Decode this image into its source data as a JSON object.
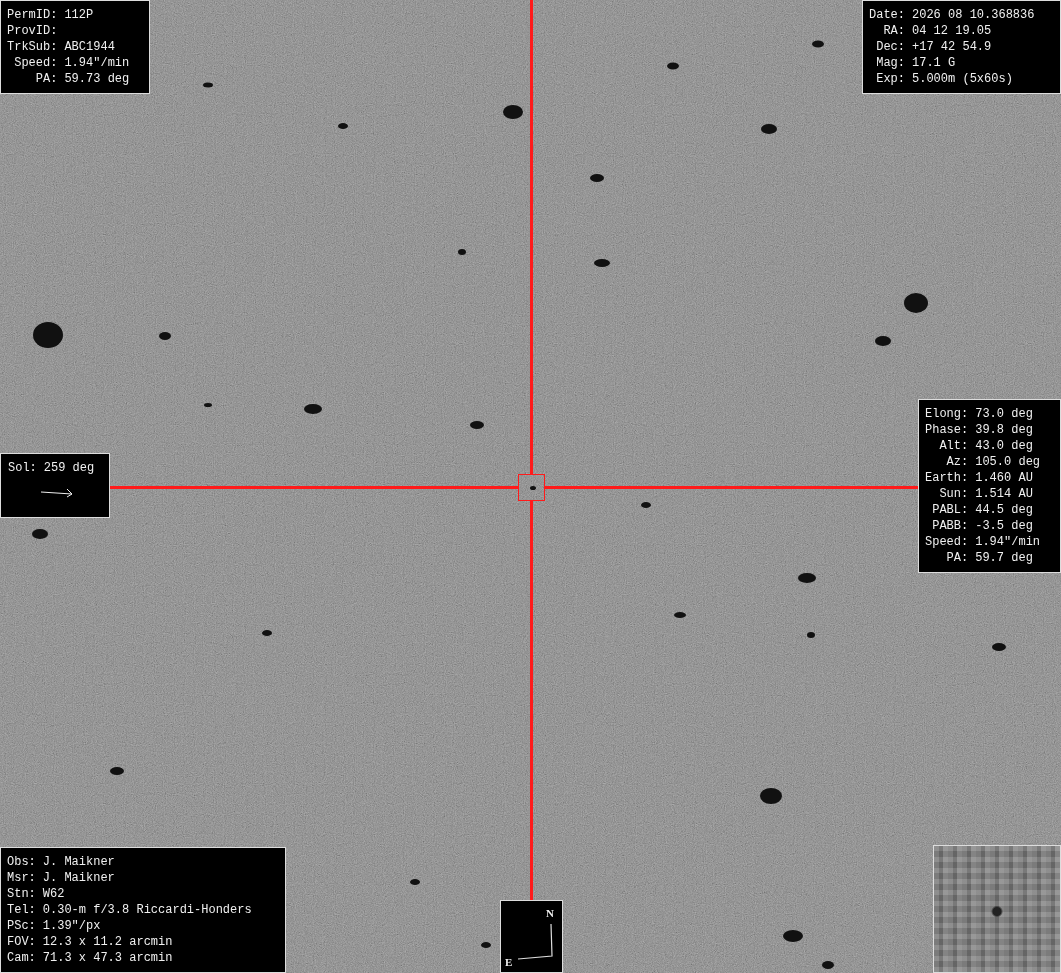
{
  "target": {
    "lines": [
      {
        "label": "PermID:",
        "value": "112P"
      },
      {
        "label": "ProvID:"
      },
      {
        "label": "TrkSub:",
        "value": "ABC1944"
      },
      {
        "label": "Speed:",
        "value": "1.94\"/min"
      },
      {
        "label": "PA:",
        "value": "59.73 deg"
      }
    ]
  },
  "observation": {
    "lines": [
      {
        "label": "Date:",
        "value": "2026 08 10.368836"
      },
      {
        "label": "RA:",
        "value": "04 12 19.05"
      },
      {
        "label": "Dec:",
        "value": "+17 42 54.9"
      },
      {
        "label": "Mag:",
        "value": "17.1 G"
      },
      {
        "label": "Exp:",
        "value": "5.000m (5x60s)"
      }
    ]
  },
  "geometry": {
    "lines": [
      {
        "label": "Elong:",
        "value": "73.0 deg"
      },
      {
        "label": "Phase:",
        "value": "39.8 deg"
      },
      {
        "label": "Alt:",
        "value": "43.0 deg"
      },
      {
        "label": "Az:",
        "value": "105.0 deg"
      },
      {
        "label": "Earth:",
        "value": "1.460 AU"
      },
      {
        "label": "Sun:",
        "value": "1.514 AU"
      },
      {
        "label": "PABL:",
        "value": "44.5 deg"
      },
      {
        "label": "PABB:",
        "value": "-3.5 deg"
      },
      {
        "label": "Speed:",
        "value": "1.94\"/min"
      },
      {
        "label": "PA:",
        "value": "59.7 deg"
      }
    ]
  },
  "solar": {
    "label": "Sol:",
    "value": "259 deg"
  },
  "observer": {
    "lines": [
      {
        "label": "Obs:",
        "value": "J. Maikner"
      },
      {
        "label": "Msr:",
        "value": "J. Maikner"
      },
      {
        "label": "Stn:",
        "value": "W62"
      },
      {
        "label": "Tel:",
        "value": "0.30-m f/3.8 Riccardi-Honders"
      },
      {
        "label": "PSc:",
        "value": "1.39\"/px"
      },
      {
        "label": "FOV:",
        "value": "12.3 x 11.2 arcmin"
      },
      {
        "label": "Cam:",
        "value": "71.3 x 47.3 arcmin"
      }
    ]
  },
  "compass": {
    "north": "N",
    "east": "E"
  }
}
